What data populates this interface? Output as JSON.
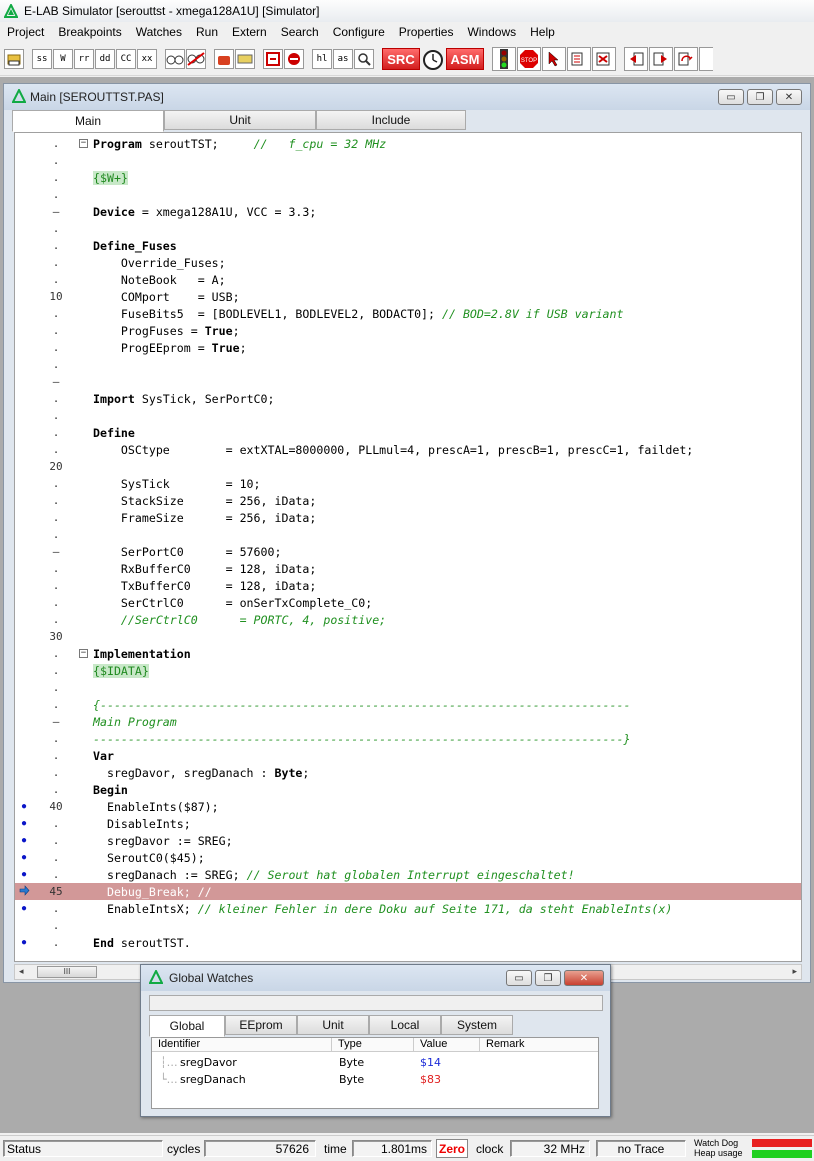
{
  "app": {
    "title": "E-LAB Simulator [serouttst - xmega128A1U] [Simulator]"
  },
  "menu": [
    "Project",
    "Breakpoints",
    "Watches",
    "Run",
    "Extern",
    "Search",
    "Configure",
    "Properties",
    "Windows",
    "Help"
  ],
  "toolbar": {
    "buttons": [
      "ss",
      "W",
      "rr",
      "dd",
      "CC",
      "xx"
    ],
    "step_buttons": [
      "hl",
      "as"
    ],
    "src_label": "SRC",
    "asm_label": "ASM",
    "stop_label": "STOP"
  },
  "editor": {
    "title": "Main [SEROUTTST.PAS]",
    "tabs": [
      "Main",
      "Unit",
      "Include"
    ],
    "lines": [
      {
        "n": ".",
        "bp": "",
        "fold": "-",
        "text": "Program seroutTST;     //   f_cpu = 32 MHz"
      },
      {
        "n": ".",
        "bp": "",
        "fold": "",
        "text": ""
      },
      {
        "n": ".",
        "bp": "",
        "fold": "",
        "text": "{$W+}"
      },
      {
        "n": ".",
        "bp": "",
        "fold": "",
        "text": ""
      },
      {
        "n": "–",
        "bp": "",
        "fold": "",
        "text": "Device = xmega128A1U, VCC = 3.3;"
      },
      {
        "n": ".",
        "bp": "",
        "fold": "",
        "text": ""
      },
      {
        "n": ".",
        "bp": "",
        "fold": "",
        "text": "Define_Fuses"
      },
      {
        "n": ".",
        "bp": "",
        "fold": "",
        "text": "    Override_Fuses;"
      },
      {
        "n": ".",
        "bp": "",
        "fold": "",
        "text": "    NoteBook   = A;"
      },
      {
        "n": "10",
        "bp": "",
        "fold": "",
        "text": "    COMport    = USB;"
      },
      {
        "n": ".",
        "bp": "",
        "fold": "",
        "text": "    FuseBits5  = [BODLEVEL1, BODLEVEL2, BODACT0]; // BOD=2.8V if USB variant"
      },
      {
        "n": ".",
        "bp": "",
        "fold": "",
        "text": "    ProgFuses = True;"
      },
      {
        "n": ".",
        "bp": "",
        "fold": "",
        "text": "    ProgEEprom = True;"
      },
      {
        "n": ".",
        "bp": "",
        "fold": "",
        "text": ""
      },
      {
        "n": "–",
        "bp": "",
        "fold": "",
        "text": ""
      },
      {
        "n": ".",
        "bp": "",
        "fold": "",
        "text": "Import SysTick, SerPortC0;"
      },
      {
        "n": ".",
        "bp": "",
        "fold": "",
        "text": ""
      },
      {
        "n": ".",
        "bp": "",
        "fold": "",
        "text": "Define"
      },
      {
        "n": ".",
        "bp": "",
        "fold": "",
        "text": "    OSCtype        = extXTAL=8000000, PLLmul=4, prescA=1, prescB=1, prescC=1, faildet;"
      },
      {
        "n": "20",
        "bp": "",
        "fold": "",
        "text": ""
      },
      {
        "n": ".",
        "bp": "",
        "fold": "",
        "text": "    SysTick        = 10;"
      },
      {
        "n": ".",
        "bp": "",
        "fold": "",
        "text": "    StackSize      = 256, iData;"
      },
      {
        "n": ".",
        "bp": "",
        "fold": "",
        "text": "    FrameSize      = 256, iData;"
      },
      {
        "n": ".",
        "bp": "",
        "fold": "",
        "text": ""
      },
      {
        "n": "–",
        "bp": "",
        "fold": "",
        "text": "    SerPortC0      = 57600;"
      },
      {
        "n": ".",
        "bp": "",
        "fold": "",
        "text": "    RxBufferC0     = 128, iData;"
      },
      {
        "n": ".",
        "bp": "",
        "fold": "",
        "text": "    TxBufferC0     = 128, iData;"
      },
      {
        "n": ".",
        "bp": "",
        "fold": "",
        "text": "    SerCtrlC0      = onSerTxComplete_C0;"
      },
      {
        "n": ".",
        "bp": "",
        "fold": "",
        "text": "    //SerCtrlC0      = PORTC, 4, positive;"
      },
      {
        "n": "30",
        "bp": "",
        "fold": "",
        "text": ""
      },
      {
        "n": ".",
        "bp": "",
        "fold": "-",
        "text": "Implementation"
      },
      {
        "n": ".",
        "bp": "",
        "fold": "",
        "text": "{$IDATA}"
      },
      {
        "n": ".",
        "bp": "",
        "fold": "",
        "text": ""
      },
      {
        "n": ".",
        "bp": "",
        "fold": "",
        "text": "{----------------------------------------------------------------------------"
      },
      {
        "n": "–",
        "bp": "",
        "fold": "",
        "text": "Main Program"
      },
      {
        "n": ".",
        "bp": "",
        "fold": "",
        "text": "----------------------------------------------------------------------------}"
      },
      {
        "n": ".",
        "bp": "",
        "fold": "",
        "text": "Var"
      },
      {
        "n": ".",
        "bp": "",
        "fold": "",
        "text": "  sregDavor, sregDanach : Byte;"
      },
      {
        "n": ".",
        "bp": "",
        "fold": "",
        "text": "Begin"
      },
      {
        "n": "40",
        "bp": "dot",
        "fold": "",
        "text": "  EnableInts($87);"
      },
      {
        "n": ".",
        "bp": "dot",
        "fold": "",
        "text": "  DisableInts;"
      },
      {
        "n": ".",
        "bp": "dot",
        "fold": "",
        "text": "  sregDavor := SREG;"
      },
      {
        "n": ".",
        "bp": "dot",
        "fold": "",
        "text": "  SeroutC0($45);"
      },
      {
        "n": ".",
        "bp": "dot",
        "fold": "",
        "text": "  sregDanach := SREG; // Serout hat globalen Interrupt eingeschaltet!"
      },
      {
        "n": "45",
        "bp": "arrow",
        "fold": "",
        "text": "  Debug_Break; //"
      },
      {
        "n": ".",
        "bp": "dot",
        "fold": "",
        "text": "  EnableIntsX; // kleiner Fehler in dere Doku auf Seite 171, da steht EnableInts(x)"
      },
      {
        "n": ".",
        "bp": "",
        "fold": "",
        "text": ""
      },
      {
        "n": ".",
        "bp": "dot",
        "fold": "",
        "text": "End seroutTST."
      }
    ],
    "scroll_thumb": "III"
  },
  "watches": {
    "title": "Global Watches",
    "tabs": [
      "Global",
      "EEprom",
      "Unit",
      "Local",
      "System"
    ],
    "columns": [
      "Identifier",
      "Type",
      "Value",
      "Remark"
    ],
    "rows": [
      {
        "id": "sregDavor",
        "type": "Byte",
        "value": "$14",
        "remark": "",
        "color": "#1c2bd8"
      },
      {
        "id": "sregDanach",
        "type": "Byte",
        "value": "$83",
        "remark": "",
        "color": "#e02020"
      }
    ]
  },
  "status": {
    "status_label": "Status",
    "cycles_label": "cycles",
    "cycles_value": "57626",
    "time_label": "time",
    "time_value": "1.801ms",
    "zero_label": "Zero",
    "clock_label": "clock",
    "clock_value": "32 MHz",
    "trace_label": "no Trace",
    "watchdog_label": "Watch Dog",
    "heap_label": "Heap usage"
  },
  "colors": {
    "highlight_line": "#d29898",
    "comment": "#209020",
    "breakpoint": "#0b16c8"
  }
}
